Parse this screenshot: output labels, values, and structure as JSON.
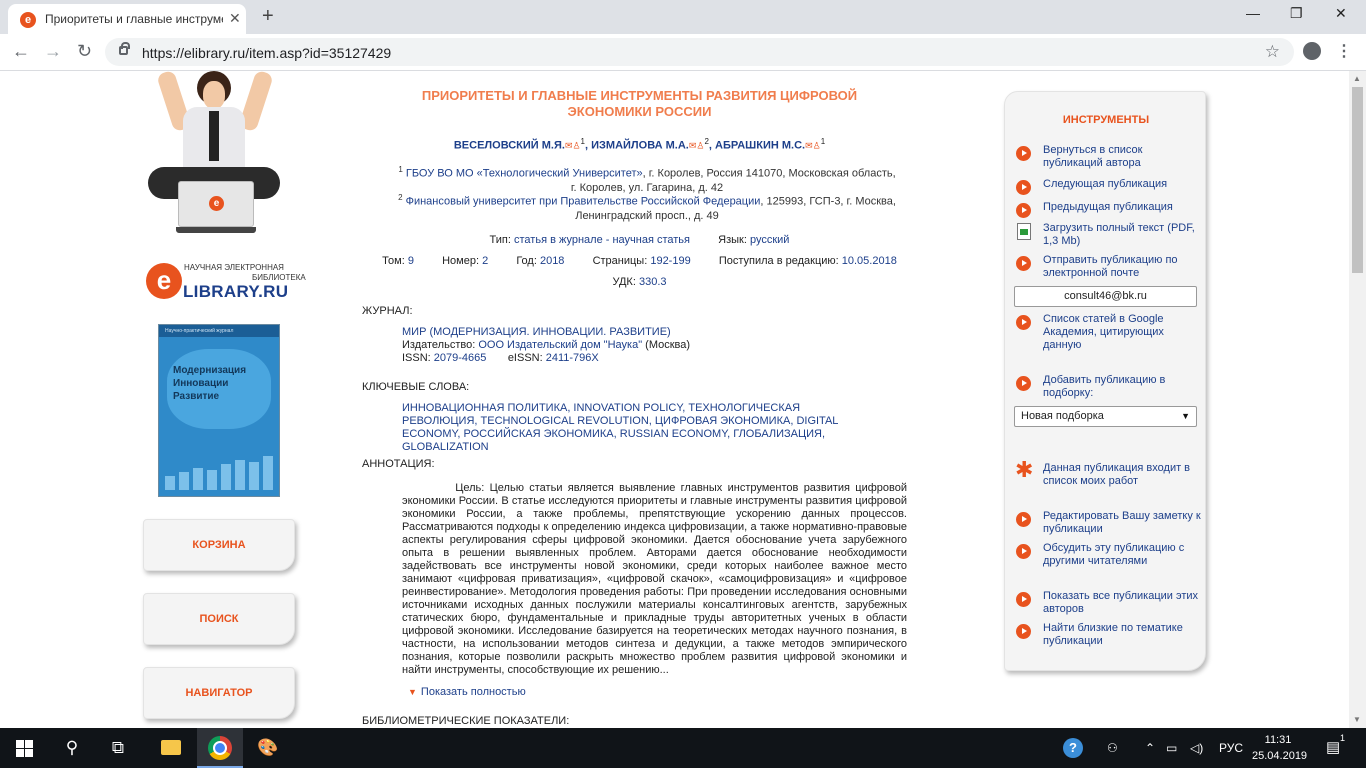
{
  "browser": {
    "tab_title": "Приоритеты и главные инструме",
    "tab_favicon": "e",
    "tab_close": "✕",
    "new_tab": "+",
    "url": "https://elibrary.ru/item.asp?id=35127429",
    "win_min": "—",
    "win_max": "❐",
    "win_close": "✕",
    "back": "←",
    "forward": "→",
    "reload": "↻",
    "star": "☆",
    "menu": "⋮"
  },
  "left": {
    "logo_letter": "e",
    "logo_tag1": "НАУЧНАЯ ЭЛЕКТРОННАЯ",
    "logo_tag2": "БИБЛИОТЕКА",
    "logo_brand": "LIBRARY.RU",
    "cover_topline": "Научно-практический журнал",
    "cover_title_1": "Модернизация",
    "cover_title_2": "Инновации",
    "cover_title_3": "Развитие",
    "buttons": [
      "КОРЗИНА",
      "ПОИСК",
      "НАВИГАТОР"
    ]
  },
  "article": {
    "title": "ПРИОРИТЕТЫ И ГЛАВНЫЕ ИНСТРУМЕНТЫ РАЗВИТИЯ ЦИФРОВОЙ ЭКОНОМИКИ РОССИИ",
    "authors": [
      {
        "name": "ВЕСЕЛОВСКИЙ М.Я.",
        "aff": "1"
      },
      {
        "name": "ИЗМАЙЛОВА М.А.",
        "aff": "2"
      },
      {
        "name": "АБРАШКИН М.С.",
        "aff": "1"
      }
    ],
    "author_icons": "✉♙",
    "affil_1_num": "1",
    "affil_1_link": "ГБОУ ВО МО «Технологический Университет»",
    "affil_1_rest": ", г. Королев, Россия 141070, Московская область, г. Королев, ул. Гагарина, д. 42",
    "affil_2_num": "2",
    "affil_2_link": "Финансовый университет при Правительстве Российской Федерации",
    "affil_2_rest": ", 125993, ГСП-3, г. Москва, Ленинградский просп., д. 49",
    "type_label": "Тип:",
    "type_value": "статья в журнале - научная статья",
    "lang_label": "Язык:",
    "lang_value": "русский",
    "vol_label": "Том:",
    "vol_value": "9",
    "num_label": "Номер:",
    "num_value": "2",
    "year_label": "Год:",
    "year_value": "2018",
    "pages_label": "Страницы:",
    "pages_value": "192-199",
    "received_label": "Поступила в редакцию:",
    "received_value": "10.05.2018",
    "udk_label": "УДК:",
    "udk_value": "330.3",
    "journal_head": "ЖУРНАЛ:",
    "journal_name": "МИР (МОДЕРНИЗАЦИЯ. ИННОВАЦИИ. РАЗВИТИЕ)",
    "publisher_label": "Издательство:",
    "publisher_value": "ООО Издательский дом \"Наука\"",
    "publisher_city": "(Москва)",
    "issn_label": "ISSN:",
    "issn_value": "2079-4665",
    "eissn_label": "eISSN:",
    "eissn_value": "2411-796X",
    "keywords_head": "КЛЮЧЕВЫЕ СЛОВА:",
    "keywords": "ИННОВАЦИОННАЯ ПОЛИТИКА, INNOVATION POLICY, ТЕХНОЛОГИЧЕСКАЯ РЕВОЛЮЦИЯ, TECHNOLOGICAL REVOLUTION, ЦИФРОВАЯ ЭКОНОМИКА, DIGITAL ECONOMY, РОССИЙСКАЯ ЭКОНОМИКА, RUSSIAN ECONOMY, ГЛОБАЛИЗАЦИЯ, GLOBALIZATION",
    "abstract_head": "АННОТАЦИЯ:",
    "abstract": "Цель: Целью статьи является выявление главных инструментов развития цифровой экономики России. В статье исследуются приоритеты и главные инструменты развития цифровой экономики России, а также проблемы, препятствующие ускорению данных процессов. Рассматриваются подходы к определению индекса цифровизации, а также нормативно-правовые аспекты регулирования сферы цифровой экономики. Дается обоснование учета зарубежного опыта в решении выявленных проблем. Авторами дается обоснование необходимости задействовать все инструменты новой экономики, среди которых наиболее важное место занимают «цифровая приватизация», «цифровой скачок», «самоцифровизация» и «цифровое реинвестирование». Методология проведения работы: При проведении исследования основными источниками исходных данных послужили материалы консалтинговых агентств, зарубежных статических бюро, фундаментальные и прикладные труды авторитетных ученых в области цифровой экономики. Исследование базируется на теоретических методах научного познания, в частности, на использовании методов синтеза и дедукции, а также методов эмпирического познания, которые позволили раскрыть множество проблем развития цифровой экономики и найти инструменты, способствующие их решению...",
    "show_full": "Показать полностью",
    "biblio_head": "БИБЛИОМЕТРИЧЕСКИЕ ПОКАЗАТЕЛИ:"
  },
  "tools": {
    "title": "ИНСТРУМЕНТЫ",
    "items": [
      "Вернуться в список публикаций автора",
      "Следующая публикация",
      "Предыдущая публикация",
      "Загрузить полный текст (PDF, 1,3 Mb)",
      "Отправить публикацию по электронной почте",
      "Список статей в Google Академия, цитирующих данную",
      "Добавить публикацию в подборку:",
      "Данная публикация входит в список моих работ",
      "Редактировать Вашу заметку к публикации",
      "Обсудить эту публикацию с другими читателями",
      "Показать все публикации этих авторов",
      "Найти близкие по тематике публикации"
    ],
    "email_value": "consult46@bk.ru",
    "select_value": "Новая подборка",
    "star_glyph": "✱"
  },
  "taskbar": {
    "search_glyph": "⚲",
    "taskview_glyph": "⧉",
    "paint_glyph": "🎨",
    "help_glyph": "?",
    "person_glyph": "⚇",
    "caret_glyph": "⌃",
    "net_glyph": "▭",
    "vol_glyph": "◁)",
    "lang": "РУС",
    "time": "11:31",
    "date": "25.04.2019",
    "notif_glyph": "▤",
    "notif_count": "1"
  }
}
